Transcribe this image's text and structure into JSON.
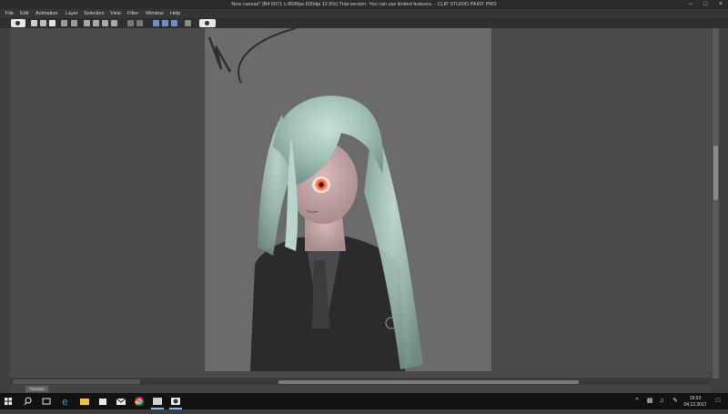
{
  "window": {
    "title": "New canvas* (B4 6071 x 8598px 600dpi 12.5%)  Trial version: You can use limited features. - CLIP STUDIO PAINT PRO",
    "minimize_icon": "minimize-icon",
    "maximize_icon": "maximize-icon",
    "close_icon": "close-icon"
  },
  "menubar": {
    "items": [
      "File",
      "Edit",
      "Animation",
      "Layer",
      "Selection",
      "View",
      "Filter",
      "Window",
      "Help"
    ]
  },
  "toolbar": {
    "icons": [
      "view-icon",
      "new-file-icon",
      "open-file-icon",
      "save-icon",
      "undo-icon",
      "redo-icon",
      "transform-icon",
      "grid-icon",
      "crop-icon",
      "ruler-icon",
      "snap-icon",
      "pen-pressure-icon",
      "select-icon",
      "lasso-icon",
      "eyedropper-icon",
      "help-icon"
    ]
  },
  "timeline": {
    "tab_label": "Timeline"
  },
  "taskbar": {
    "apps": [
      "windows-start-icon",
      "search-icon",
      "task-view-icon",
      "edge-icon",
      "file-explorer-icon",
      "store-icon",
      "mail-icon",
      "chrome-icon",
      "app-icon",
      "clip-studio-icon"
    ],
    "time": "19:53",
    "date": "04.12.2017"
  },
  "colors": {
    "workspace": "#4a4a4a",
    "canvas": "#6b6b6b",
    "hair": "#a9c7c0",
    "eye": "#ff5a28",
    "suit": "#2a2a2a"
  }
}
